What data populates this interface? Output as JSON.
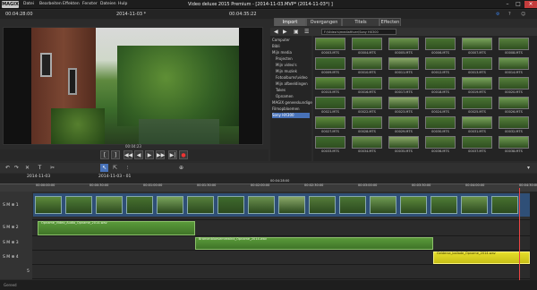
{
  "app": {
    "logo": "MAGIX",
    "title": "Video deluxe 2015 Premium - [2014-11-03.MVP* (2014-11-03*) ]",
    "menu": [
      "Datei",
      "Bearbeiten",
      "Effekten",
      "Fenster",
      "Dateien",
      "Hulp"
    ]
  },
  "toolbar": {
    "time_left": "00:04:28:00",
    "project_name": "2014-11-03 *",
    "time_right": "00:04:35:22"
  },
  "browser_tabs": [
    "Import",
    "Overgangen",
    "Titels",
    "Effecten"
  ],
  "browser": {
    "path": "F:\\Video's\\mediaHiver\\Sony HX300",
    "tree": [
      "Computer",
      "Bibli",
      "Mijn media",
      "Projecten",
      "Mijn video's",
      "Mijn muziek",
      "Fotoalbums\\video",
      "Mijn afbeeldingen",
      "Takes",
      "Opnamen",
      "MAGIX geneeskundige",
      "Filmopbloemen",
      "Sony HX300"
    ],
    "thumbs": [
      "00003.MTS",
      "00004.MTS",
      "00005.MTS",
      "00006.MTS",
      "00007.MTS",
      "00008.MTS",
      "00009.MTS",
      "00010.MTS",
      "00011.MTS",
      "00012.MTS",
      "00013.MTS",
      "00014.MTS",
      "00015.MTS",
      "00016.MTS",
      "00017.MTS",
      "00018.MTS",
      "00019.MTS",
      "00020.MTS",
      "00021.MTS",
      "00022.MTS",
      "00023.MTS",
      "00024.MTS",
      "00025.MTS",
      "00026.MTS",
      "00027.MTS",
      "00028.MTS",
      "00029.MTS",
      "00030.MTS",
      "00031.MTS",
      "00032.MTS",
      "00033.MTS",
      "00034.MTS",
      "00035.MTS",
      "00036.MTS",
      "00037.MTS",
      "00038.MTS"
    ]
  },
  "monitor": {
    "timecode": "00:04:23"
  },
  "transport": [
    "[",
    "]",
    "◀◀",
    "◀",
    "▶",
    "▶▶",
    "▶|",
    "●"
  ],
  "timeline": {
    "tab": "2014-11-03",
    "tab2": "2014-11-03 - 01",
    "ruler": [
      "00:00:00:00",
      "00:00:30:00",
      "00:01:00:00",
      "00:01:30:00",
      "00:02:00:00",
      "00:02:30:00",
      "00:03:00:00",
      "00:03:30:00",
      "00:04:00:00",
      "00:04:30:00"
    ],
    "playhead_label": "00:04:28:00",
    "tracks": [
      "S M ⊕ 1",
      "S M ⊕ 2",
      "S M ⊕ 3",
      "S M ⊕ 4",
      "5"
    ],
    "audio_clip1": "Opname_Video_Audio_Opname_2014.wav",
    "audio_clip2": "Bramenbloesemrewind_Opname_2014.wav",
    "audio_clip3": "Gelderse_ballade_Opname_2014.wav"
  },
  "status": {
    "text": "Gereed"
  }
}
